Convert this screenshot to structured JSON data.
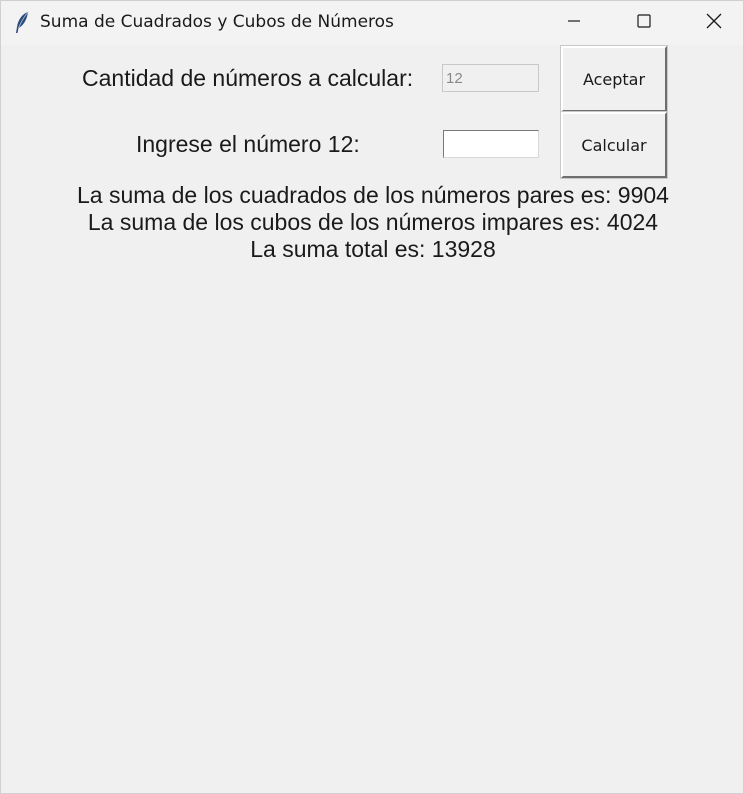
{
  "window": {
    "title": "Suma de Cuadrados y Cubos de Números",
    "app_icon": "feather-icon",
    "controls": {
      "minimize_icon": "minimize-icon",
      "maximize_icon": "maximize-icon",
      "close_icon": "close-icon"
    }
  },
  "form": {
    "count_label": "Cantidad de números a calcular:",
    "count_value": "12",
    "accept_button": "Aceptar",
    "number_label": "Ingrese el número 12:",
    "number_value": "",
    "calculate_button": "Calcular"
  },
  "results": {
    "line_even_squares": "La suma de los cuadrados de los números pares es: 9904",
    "line_odd_cubes": "La suma de los cubos de los números impares es: 4024",
    "line_total": "La suma total es: 13928"
  }
}
